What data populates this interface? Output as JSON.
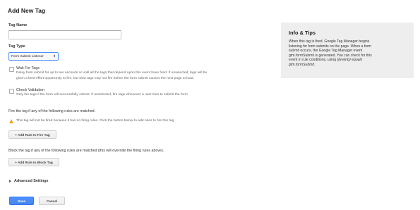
{
  "page_title": "Add New Tag",
  "tag_name": {
    "label": "Tag Name",
    "value": ""
  },
  "tag_type": {
    "label": "Tag Type",
    "selected": "Form Submit Listener"
  },
  "options": {
    "wait_for_tags": {
      "label": "Wait For Tags",
      "desc_line1": "Delay form submit for up to two seconds or until all the tags that depend upon this event have fired. If unselected, tags will be",
      "desc_line2": "given a best-effort opportunity to fire, but slow tags may not fire before the form submit causes the next page to load."
    },
    "check_validation": {
      "label": "Check Validation",
      "desc": "Only fire tags if the form will successfully submit. If unselected, fire tags whenever a user tries to submit the form."
    }
  },
  "firing": {
    "heading": "Fire the tag if any of the following rules are matched.",
    "warning": "This tag will not be fired because it has no firing rules. Click the button below to add rules to fire this tag.",
    "add_button": "+ Add Rule to Fire Tag"
  },
  "blocking": {
    "heading": "Block the tag if any of the following rules are matched (this will override the firing rules above).",
    "add_button": "+ Add Rule to Block Tag"
  },
  "advanced": {
    "label": "Advanced Settings"
  },
  "actions": {
    "save": "Save",
    "cancel": "Cancel"
  },
  "info": {
    "title": "Info & Tips",
    "body_line1": "When this tag is fired, Google Tag Manager begins",
    "body_line2": "listening for form submits on the page. When a form",
    "body_line3": "submit occurs, the Google Tag Manager event",
    "body_line4": "gtm.formSubmit is generated. You can check for this",
    "body_line5_prefix": "event in rule conditions, using ",
    "body_line5_code": "{{event}} equals",
    "body_line6_code": "gtm.formSubmit",
    "body_line6_suffix": "."
  },
  "colors": {
    "primary_button": "#4d90fe",
    "warning_icon": "#e6a817",
    "tips_bg": "#eeeeee"
  }
}
